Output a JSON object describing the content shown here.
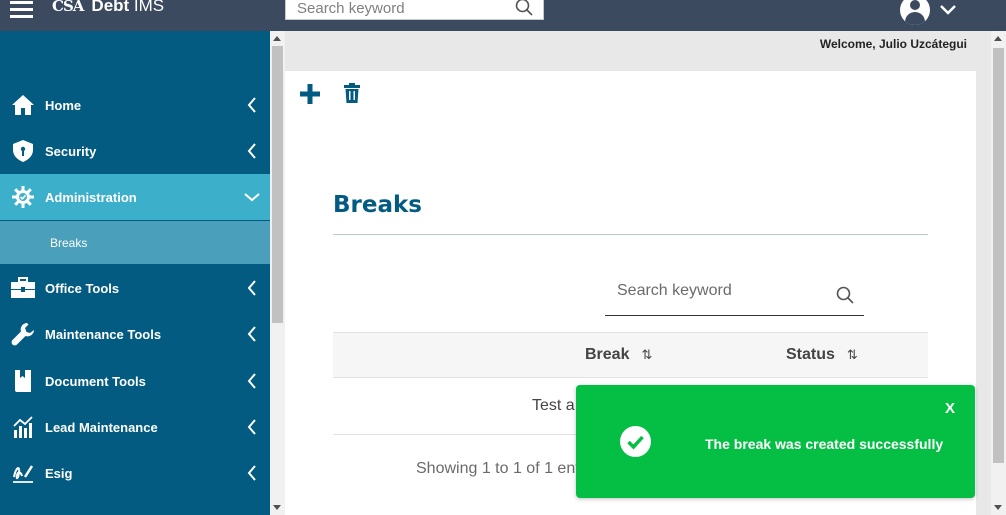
{
  "header": {
    "logo_mark": "CSA",
    "logo_name_bold": "Debt",
    "logo_name_rest": " IMS",
    "search_placeholder": "Search keyword"
  },
  "welcome": "Welcome, Julio Uzcátegui",
  "sidebar": {
    "items": [
      {
        "label": "Home",
        "icon": "home-icon"
      },
      {
        "label": "Security",
        "icon": "shield-icon"
      },
      {
        "label": "Administration",
        "icon": "gear-icon"
      },
      {
        "label": "Office Tools",
        "icon": "toolbox-icon"
      },
      {
        "label": "Maintenance Tools",
        "icon": "wrench-icon"
      },
      {
        "label": "Document Tools",
        "icon": "book-icon"
      },
      {
        "label": "Lead Maintenance",
        "icon": "bar-chart-icon"
      },
      {
        "label": "Esig",
        "icon": "signature-icon"
      }
    ],
    "sub_item": "Breaks"
  },
  "page": {
    "title": "Breaks",
    "search_placeholder": "Search keyword",
    "columns": [
      "Break",
      "Status"
    ],
    "rows": [
      {
        "break": "Test a"
      }
    ],
    "showing": "Showing 1 to 1 of 1 ent"
  },
  "toast": {
    "close": "X",
    "message": "The break was created successfully"
  },
  "colors": {
    "topbar": "#3b4a5f",
    "sidebar": "#035b82",
    "active": "#3cafcb",
    "toast": "#05bf45",
    "title": "#035b82"
  }
}
